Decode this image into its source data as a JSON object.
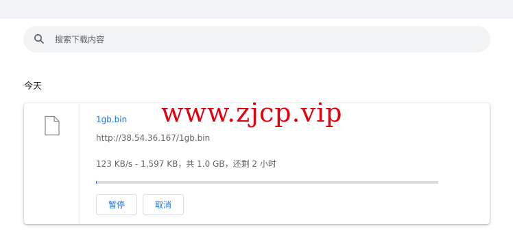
{
  "search": {
    "placeholder": "搜索下载内容",
    "icon": "search-icon"
  },
  "downloads": {
    "date_header": "今天",
    "item": {
      "file_icon": "file-icon",
      "file_name": "1gb.bin",
      "url": "http://38.54.36.167/1gb.bin",
      "status": "123 KB/s - 1,597 KB，共 1.0 GB，还剩 2 小时",
      "progress_fraction": 0.0016,
      "buttons": {
        "pause": "暂停",
        "cancel": "取消"
      }
    }
  },
  "watermark": {
    "text": "www.zjcp.vip"
  },
  "colors": {
    "accent": "#1a73e8",
    "watermark": "#e3000f"
  }
}
